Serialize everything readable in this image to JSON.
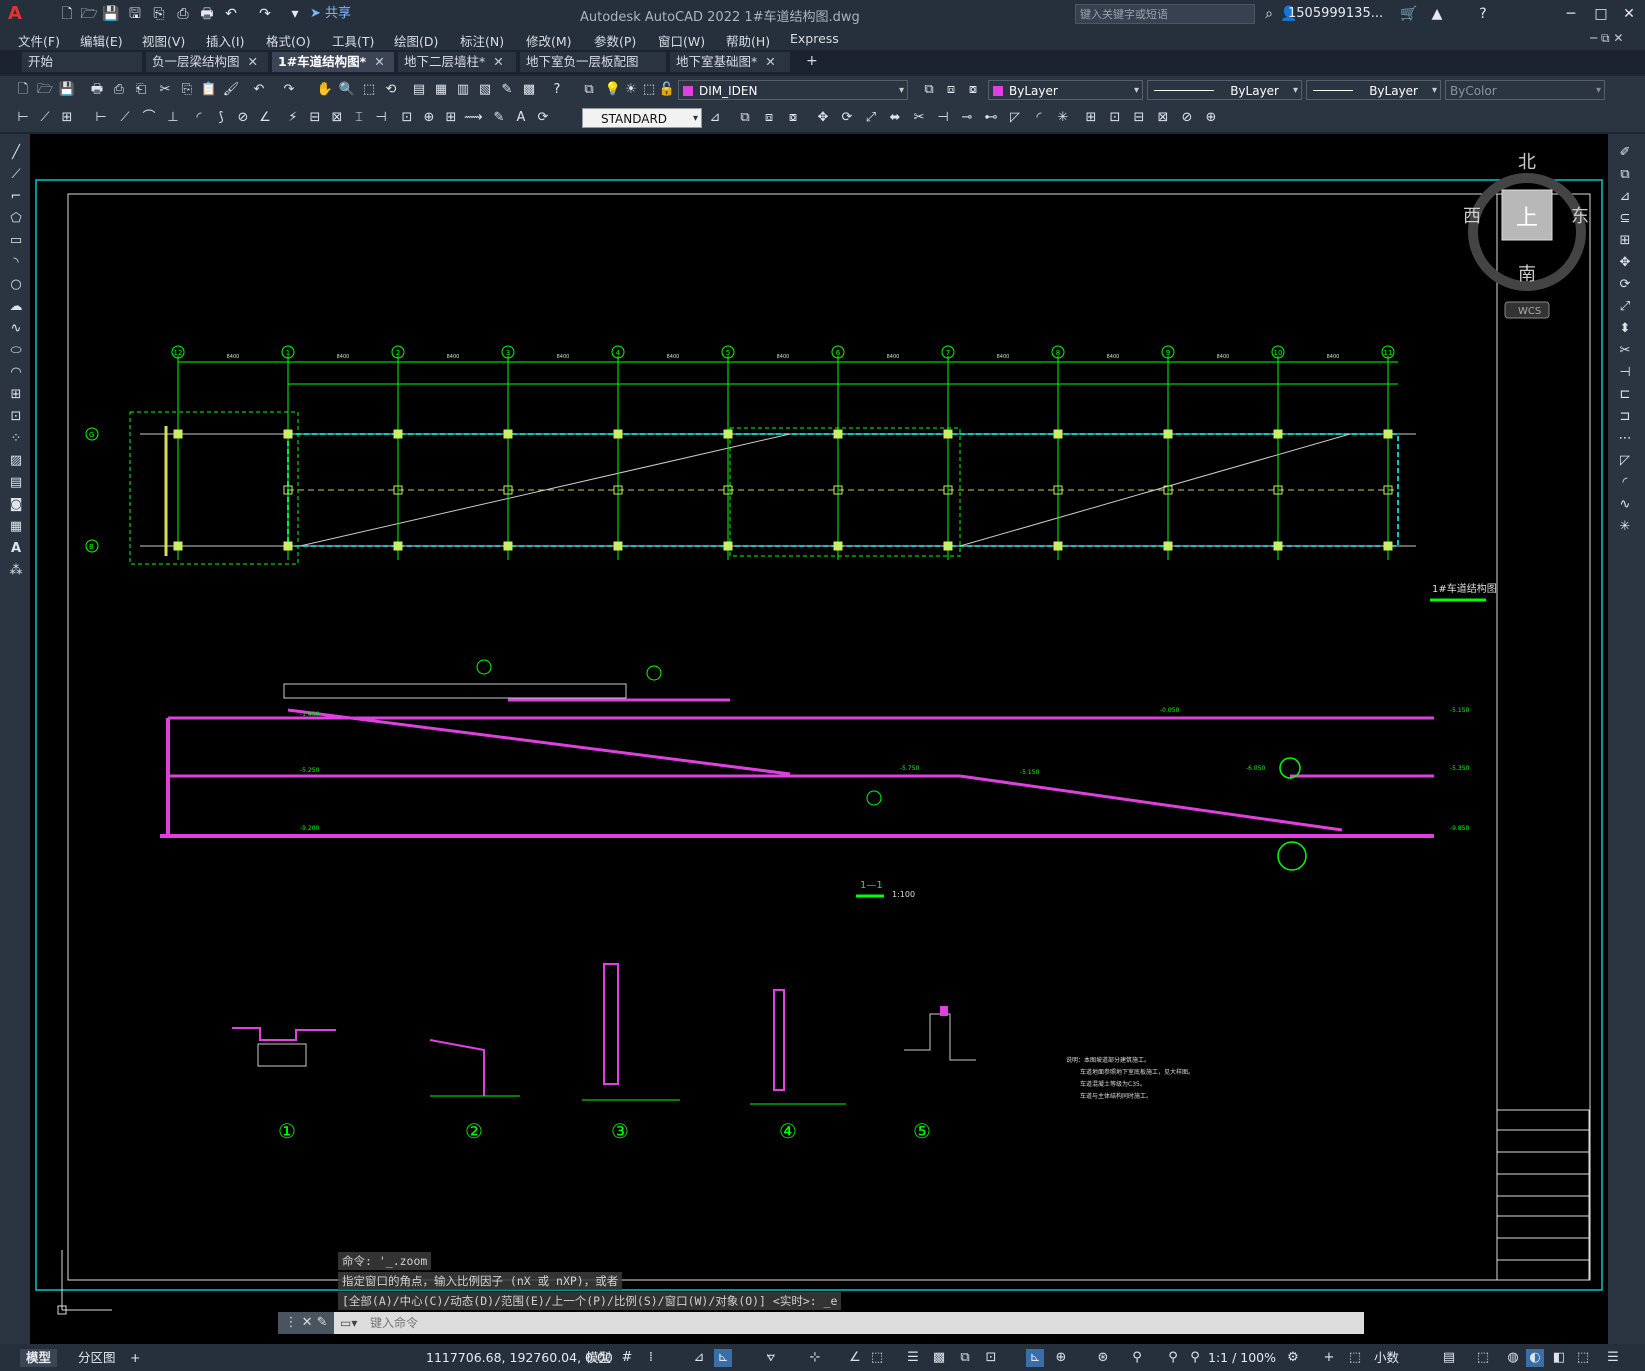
{
  "titlebar": {
    "app_logo": "A",
    "share_label": "共享",
    "title": "Autodesk AutoCAD 2022    1#车道结构图.dwg",
    "search_placeholder": "键入关键字或短语",
    "user": "1505999135...",
    "minimize": "─",
    "maximize": "□",
    "close": "✕"
  },
  "menu": [
    "文件(F)",
    "编辑(E)",
    "视图(V)",
    "插入(I)",
    "格式(O)",
    "工具(T)",
    "绘图(D)",
    "标注(N)",
    "修改(M)",
    "参数(P)",
    "窗口(W)",
    "帮助(H)",
    "Express"
  ],
  "tabs": [
    {
      "label": "开始",
      "closable": false
    },
    {
      "label": "负一层梁结构图",
      "closable": true
    },
    {
      "label": "1#车道结构图*",
      "closable": true,
      "active": true
    },
    {
      "label": "地下二层墙柱*",
      "closable": true
    },
    {
      "label": "地下室负一层板配图*",
      "closable": true
    },
    {
      "label": "地下室基础图*",
      "closable": true
    }
  ],
  "tab_add": "+",
  "toolbar": {
    "layer": "DIM_IDEN",
    "color": "ByLayer",
    "linetype": "ByLayer",
    "lineweight": "ByLayer",
    "plotstyle": "ByColor",
    "textstyle": "STANDARD"
  },
  "viewcube": {
    "north": "北",
    "south": "南",
    "east": "东",
    "west": "西",
    "top": "上",
    "wcs": "WCS"
  },
  "drawing": {
    "plan_title": "1#车道结构图",
    "section_label": "1—1",
    "section_scale": "1:100",
    "detail_numbers": [
      "①",
      "②",
      "③",
      "④",
      "⑤"
    ],
    "grid_numbers": [
      "12",
      "1",
      "2",
      "3",
      "4",
      "5",
      "6",
      "7",
      "8",
      "9",
      "10",
      "11"
    ],
    "grid_letters": [
      "G",
      "B"
    ],
    "span": "8400",
    "notes": [
      "说明：本图坡道部分建筑施工。",
      "车道地面参照地下室底板施工，见大样图。",
      "车道混凝土等级为C35。",
      "车道与主体结构同时施工。"
    ],
    "elevations": [
      "-1.450",
      "-5.250",
      "-9.200",
      "-0.050",
      "-5.150",
      "-5.750",
      "-6.050",
      "-5.350",
      "-5.150",
      "-9.850"
    ]
  },
  "command": {
    "line1": "命令: '_.zoom",
    "line2": "指定窗口的角点，输入比例因子 (nX 或 nXP)，或者",
    "line3": "[全部(A)/中心(C)/动态(D)/范围(E)/上一个(P)/比例(S)/窗口(W)/对象(O)] <实时>: _e",
    "input_placeholder": "键入命令"
  },
  "layout_tabs": [
    {
      "label": "模型",
      "active": true
    },
    {
      "label": "分区图",
      "active": false
    }
  ],
  "layout_add": "+",
  "status": {
    "coords": "1117706.68, 192760.04, 0.00",
    "space": "模型",
    "scale": "1:1 / 100%",
    "units": "小数"
  },
  "colors": {
    "accent": "#3b4555",
    "cad_green": "#00ff00",
    "cad_magenta": "#e040e0",
    "cad_cyan": "#00c8c8"
  }
}
